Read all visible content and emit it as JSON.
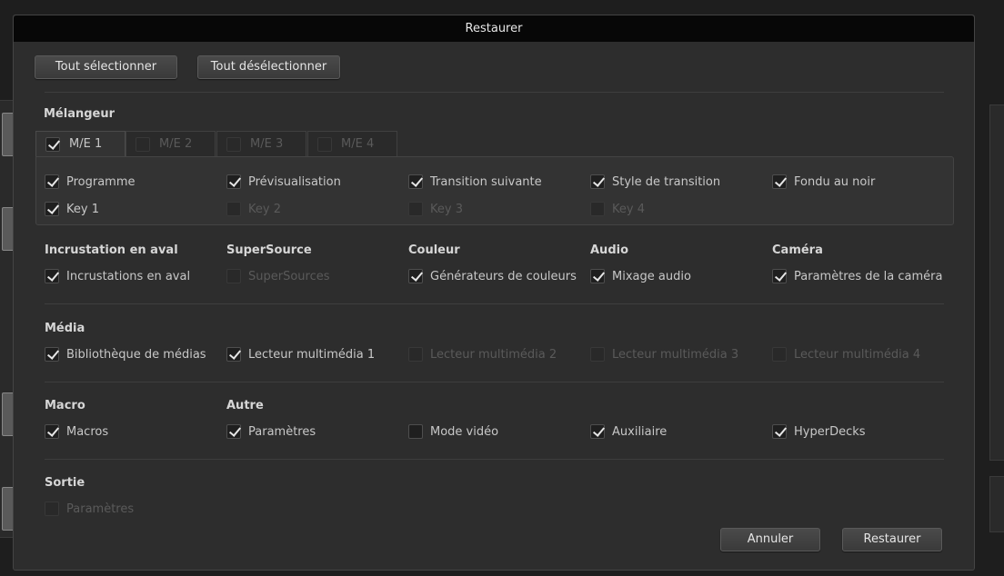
{
  "dialog": {
    "title": "Restaurer",
    "select_all": "Tout sélectionner",
    "deselect_all": "Tout désélectionner",
    "cancel": "Annuler",
    "restore": "Restaurer"
  },
  "mixer": {
    "heading": "Mélangeur",
    "tabs": [
      {
        "label": "M/E 1",
        "checked": true,
        "enabled": true
      },
      {
        "label": "M/E 2",
        "checked": false,
        "enabled": false
      },
      {
        "label": "M/E 3",
        "checked": false,
        "enabled": false
      },
      {
        "label": "M/E 4",
        "checked": false,
        "enabled": false
      }
    ],
    "options": [
      {
        "label": "Programme",
        "checked": true,
        "enabled": true
      },
      {
        "label": "Prévisualisation",
        "checked": true,
        "enabled": true
      },
      {
        "label": "Transition suivante",
        "checked": true,
        "enabled": true
      },
      {
        "label": "Style de transition",
        "checked": true,
        "enabled": true
      },
      {
        "label": "Fondu au noir",
        "checked": true,
        "enabled": true
      },
      {
        "label": "Key 1",
        "checked": true,
        "enabled": true
      },
      {
        "label": "Key 2",
        "checked": false,
        "enabled": false
      },
      {
        "label": "Key 3",
        "checked": false,
        "enabled": false
      },
      {
        "label": "Key 4",
        "checked": false,
        "enabled": false
      }
    ]
  },
  "row2": [
    {
      "heading": "Incrustation en aval",
      "label": "Incrustations en aval",
      "checked": true,
      "enabled": true
    },
    {
      "heading": "SuperSource",
      "label": "SuperSources",
      "checked": false,
      "enabled": false
    },
    {
      "heading": "Couleur",
      "label": "Générateurs de couleurs",
      "checked": true,
      "enabled": true
    },
    {
      "heading": "Audio",
      "label": "Mixage audio",
      "checked": true,
      "enabled": true
    },
    {
      "heading": "Caméra",
      "label": "Paramètres de la caméra",
      "checked": true,
      "enabled": true
    }
  ],
  "media": {
    "heading": "Média",
    "options": [
      {
        "label": "Bibliothèque de médias",
        "checked": true,
        "enabled": true
      },
      {
        "label": "Lecteur multimédia 1",
        "checked": true,
        "enabled": true
      },
      {
        "label": "Lecteur multimédia 2",
        "checked": false,
        "enabled": false
      },
      {
        "label": "Lecteur multimédia 3",
        "checked": false,
        "enabled": false
      },
      {
        "label": "Lecteur multimédia 4",
        "checked": false,
        "enabled": false
      }
    ]
  },
  "macro": {
    "heading": "Macro"
  },
  "other": {
    "heading": "Autre"
  },
  "row4": [
    {
      "label": "Macros",
      "checked": true,
      "enabled": true
    },
    {
      "label": "Paramètres",
      "checked": true,
      "enabled": true
    },
    {
      "label": "Mode vidéo",
      "checked": false,
      "enabled": true
    },
    {
      "label": "Auxiliaire",
      "checked": true,
      "enabled": true
    },
    {
      "label": "HyperDecks",
      "checked": true,
      "enabled": true
    }
  ],
  "output": {
    "heading": "Sortie",
    "option": {
      "label": "Paramètres",
      "checked": false,
      "enabled": false
    }
  }
}
